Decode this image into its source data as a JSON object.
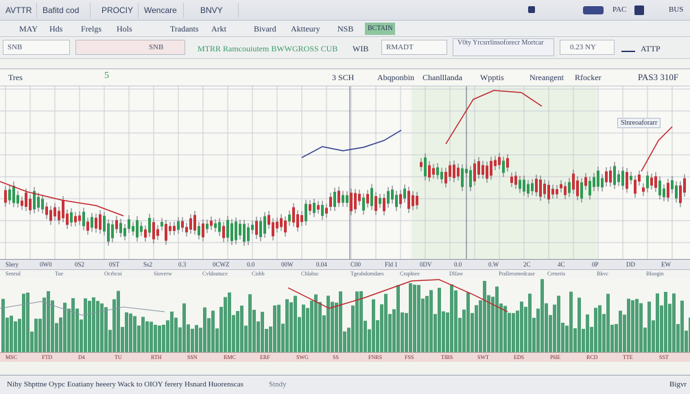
{
  "window": {
    "tabs": [
      "AVTTR",
      "Bafitd cod",
      "PROCIY",
      "Wencare",
      "BNVY"
    ],
    "top_right": [
      "PAC",
      "BUS"
    ]
  },
  "menu": {
    "items": [
      "MAY",
      "Hds",
      "Frelgs",
      "Hols",
      "Tradants",
      "Arkt",
      "Bivard",
      "Aktteury",
      "NSB",
      "BCTAIN"
    ]
  },
  "toolbar": {
    "symbol_field": "SNB",
    "interval_field": "SNB",
    "title_text": "MTRR Ramcouiutem BWWGROSS CUB",
    "mid_label": "WIB",
    "range_field": "RMADT",
    "info_box": "V0ty  Yrcsrrlinsoforecr Mortcar",
    "price_field": "0.23",
    "price_field_suffix": "NY",
    "right_label": "ATTP"
  },
  "chart_header": {
    "left_label": "Tres",
    "value_label": "5",
    "mid_value": "3 SCH",
    "items": [
      "Abqponbin",
      "Chanlllanda",
      "Wpptis",
      "Nreangent",
      "Rfocker"
    ],
    "right_value": "PAS3 310F"
  },
  "annotations": {
    "note": "Slnreoaforarr"
  },
  "price_axis_labels": [
    "Slery",
    "0W0",
    "0S2",
    "0ST",
    "Ss2",
    "0.3",
    "0CWZ",
    "0.0",
    "00W",
    "0.04",
    "C00",
    "Fld 1",
    "0DV",
    "0.0",
    "0.W",
    "2C",
    "4C",
    "0P",
    "DD",
    "EW"
  ],
  "date_axis_labels": [
    "Senrsd",
    "Tue",
    "Ocrbcoi",
    "Sioverw",
    "Cvldoutuce",
    "Cisbb",
    "Chlabsc",
    "Tgeabdomdaes",
    "Craphiee",
    "Dlfaw",
    "Pralleromedcase",
    "Crrneris",
    "Bkvc",
    "Bloogin"
  ],
  "volume_axis_labels": [
    "MSC",
    "FTD",
    "D4",
    "TU",
    "RTH",
    "SSN",
    "RMC",
    "ERF",
    "SWG",
    "SS",
    "FNRS",
    "FSS",
    "TIBS",
    "SWT",
    "EDS",
    "PHE",
    "RCD",
    "TTE",
    "SST"
  ],
  "status": {
    "text": "Nihy  Shpttne  Oypc Eoatiany  heeery  Wack to  OIOY ferery  Hsnard  Huorenscas",
    "mid": "Stndy",
    "right": "Bigvr"
  },
  "colors": {
    "up": "#2f9a55",
    "down": "#c8333a",
    "trend": "#c0262c",
    "volume": "#2f8f5f",
    "grid": "#c9ccd3",
    "accent_blue": "#2a3a8c"
  }
}
